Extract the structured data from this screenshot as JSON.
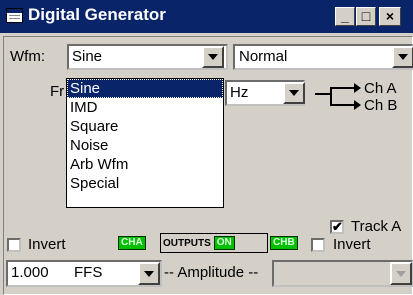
{
  "window": {
    "title": "Digital Generator"
  },
  "title_buttons": {
    "minimize": "_",
    "maximize": "□",
    "close": "×"
  },
  "waveform": {
    "label": "Wfm:",
    "value": "Sine",
    "mode_value": "Normal",
    "options": [
      "Sine",
      "IMD",
      "Square",
      "Noise",
      "Arb Wfm",
      "Special"
    ],
    "selected_index": 0
  },
  "frequency": {
    "label_partial": "Fr",
    "unit_value": "Hz"
  },
  "routing": {
    "ch_a": "Ch A",
    "ch_b": "Ch B"
  },
  "track": {
    "label": "Track A",
    "checked": true
  },
  "invert_a": {
    "label": "Invert",
    "checked": false
  },
  "invert_b": {
    "label": "Invert",
    "checked": false
  },
  "chips": {
    "cha": "CHA",
    "outputs": "OUTPUTS",
    "on": "ON",
    "chb": "CHB"
  },
  "amplitude": {
    "value": "1.000",
    "unit": "FFS",
    "label": "-- Amplitude --"
  }
}
